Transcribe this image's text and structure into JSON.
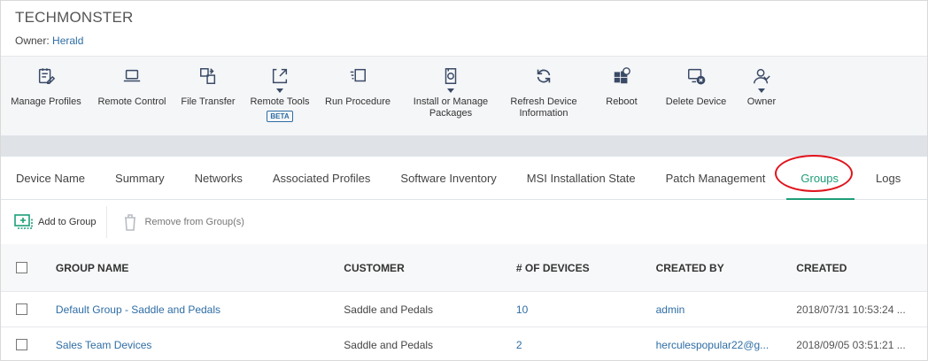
{
  "header": {
    "title": "TECHMONSTER",
    "owner_label": "Owner:",
    "owner_name": "Herald"
  },
  "toolbar": {
    "items": [
      {
        "label": "Manage Profiles",
        "icon": "manage-profiles-icon"
      },
      {
        "label": "Remote Control",
        "icon": "laptop-icon"
      },
      {
        "label": "File Transfer",
        "icon": "file-transfer-icon"
      },
      {
        "label": "Remote Tools",
        "icon": "remote-tools-icon",
        "badge": "BETA",
        "dropdown": true
      },
      {
        "label": "Run Procedure",
        "icon": "run-procedure-icon"
      },
      {
        "label": "Install or Manage Packages",
        "icon": "package-icon",
        "dropdown": true
      },
      {
        "label": "Refresh Device Information",
        "icon": "refresh-icon"
      },
      {
        "label": "Reboot",
        "icon": "windows-reboot-icon"
      },
      {
        "label": "Delete Device",
        "icon": "delete-device-icon"
      },
      {
        "label": "Owner",
        "icon": "owner-icon",
        "dropdown": true
      }
    ]
  },
  "tabs": [
    "Device Name",
    "Summary",
    "Networks",
    "Associated Profiles",
    "Software Inventory",
    "MSI Installation State",
    "Patch Management",
    "Groups",
    "Logs"
  ],
  "active_tab": "Groups",
  "actions": {
    "add": "Add to Group",
    "remove": "Remove from Group(s)"
  },
  "table": {
    "columns": [
      "GROUP NAME",
      "CUSTOMER",
      "# OF DEVICES",
      "CREATED BY",
      "CREATED"
    ],
    "rows": [
      {
        "group": "Default Group - Saddle and Pedals",
        "customer": "Saddle and Pedals",
        "devices": "10",
        "created_by": "admin",
        "created": "2018/07/31 10:53:24 ..."
      },
      {
        "group": "Sales Team Devices",
        "customer": "Saddle and Pedals",
        "devices": "2",
        "created_by": "herculespopular22@g...",
        "created": "2018/09/05 03:51:21 ..."
      }
    ]
  },
  "colors": {
    "accent_green": "#1d9e78",
    "link_blue": "#2e6da4",
    "highlight_red": "#e0141d",
    "icon_navy": "#3a4a66"
  }
}
